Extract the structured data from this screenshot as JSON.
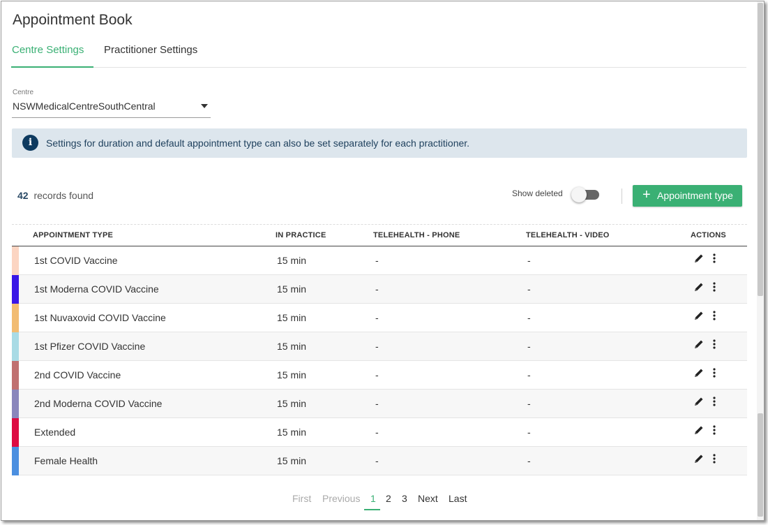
{
  "page": {
    "title": "Appointment Book"
  },
  "tabs": [
    {
      "label": "Centre Settings",
      "active": true
    },
    {
      "label": "Practitioner Settings",
      "active": false
    }
  ],
  "centre": {
    "label": "Centre",
    "value": "NSWMedicalCentreSouthCentral"
  },
  "info": {
    "icon": "info-icon",
    "symbol": "i",
    "text": "Settings for duration and default appointment type can also be set separately for each practitioner."
  },
  "records": {
    "count": "42",
    "label": "records found"
  },
  "toolbar": {
    "show_deleted_label": "Show deleted",
    "show_deleted_on": false,
    "add_plus": "+",
    "add_label": "Appointment type"
  },
  "table": {
    "headers": [
      "APPOINTMENT TYPE",
      "IN PRACTICE",
      "TELEHEALTH - PHONE",
      "TELEHEALTH - VIDEO",
      "ACTIONS"
    ],
    "rows": [
      {
        "color": "#fcd5c2",
        "name": "1st COVID Vaccine",
        "in_practice": "15 min",
        "phone": "-",
        "video": "-"
      },
      {
        "color": "#3a17e6",
        "name": "1st Moderna COVID Vaccine",
        "in_practice": "15 min",
        "phone": "-",
        "video": "-"
      },
      {
        "color": "#f2bc72",
        "name": "1st Nuvaxovid COVID Vaccine",
        "in_practice": "15 min",
        "phone": "-",
        "video": "-"
      },
      {
        "color": "#a9dbe5",
        "name": "1st Pfizer COVID Vaccine",
        "in_practice": "15 min",
        "phone": "-",
        "video": "-"
      },
      {
        "color": "#c07070",
        "name": "2nd COVID Vaccine",
        "in_practice": "15 min",
        "phone": "-",
        "video": "-"
      },
      {
        "color": "#8a86bc",
        "name": "2nd Moderna COVID Vaccine",
        "in_practice": "15 min",
        "phone": "-",
        "video": "-"
      },
      {
        "color": "#dd0b42",
        "name": "Extended",
        "in_practice": "15 min",
        "phone": "-",
        "video": "-"
      },
      {
        "color": "#4b8fe0",
        "name": "Female Health",
        "in_practice": "15 min",
        "phone": "-",
        "video": "-"
      }
    ],
    "action_icons": [
      "pencil-icon",
      "more-vertical-icon"
    ]
  },
  "pagination": {
    "first": "First",
    "previous": "Previous",
    "pages": [
      "1",
      "2",
      "3"
    ],
    "current": "1",
    "next": "Next",
    "last": "Last"
  },
  "colors": {
    "accent": "#3ab074",
    "info_bg": "#dde6ed",
    "info_icon": "#0e3a5f"
  }
}
